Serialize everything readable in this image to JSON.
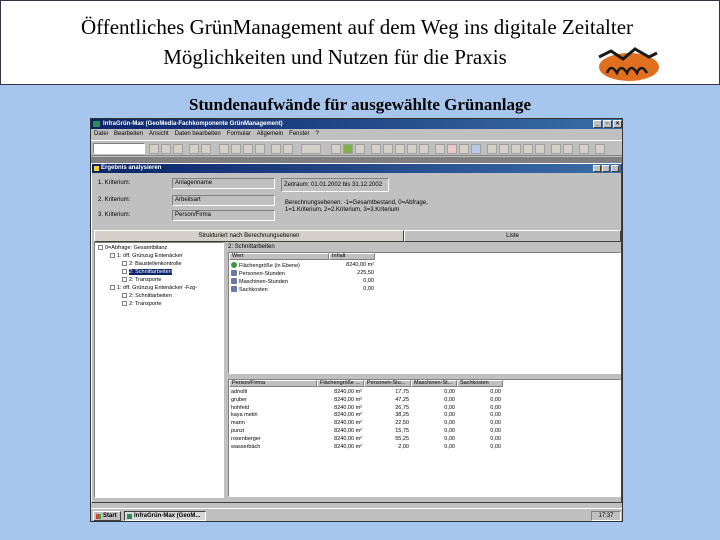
{
  "slide": {
    "title_line1": "Öffentliches GrünManagement auf dem Weg ins digitale Zeitalter",
    "title_line2": "Möglichkeiten und Nutzen für die Praxis",
    "subtitle": "Stundenaufwände für ausgewählte Grünanlage"
  },
  "app": {
    "window_title": "InfraGrün-Max (GeoMedia-Fachkomponente GrünManagement)",
    "window_controls": [
      "_",
      "▫",
      "×"
    ],
    "menu": [
      "Datei",
      "Bearbeiten",
      "Ansicht",
      "Daten bearbeiten",
      "Formular",
      "Allgemein",
      "Fenster",
      "?"
    ]
  },
  "dialog": {
    "title": "Ergebnis analysieren",
    "criteria": [
      {
        "label": "1. Kriterium:",
        "value": "Anlagenname"
      },
      {
        "label": "2. Kriterium:",
        "value": "Arbeitsart"
      },
      {
        "label": "3. Kriterium:",
        "value": "Person/Firma"
      }
    ],
    "zeitraum": "Zeitraum: 01.01.2002 bis 31.12.2002",
    "ebenen_line1": "Berechnungsebenen: -1=Gesamtbestand, 0=Abfrage,",
    "ebenen_line2": "1=1.Kriterium, 2=2.Kriterium, 3=3.Kriterium",
    "tabs": [
      "Strukturiert nach Berechnungsebenen",
      "Liste"
    ],
    "tree": [
      {
        "label": "0=Abfrage: Gesamtbilanz",
        "level": 0,
        "selected": false
      },
      {
        "label": "1: öff. Grünzug Entenäcker",
        "level": 1,
        "selected": false
      },
      {
        "label": "2: Baustellenkontrolle",
        "level": 2,
        "selected": false
      },
      {
        "label": "2: Schnittarbeiten",
        "level": 2,
        "selected": true
      },
      {
        "label": "2: Transporte",
        "level": 2,
        "selected": false
      },
      {
        "label": "1: öff. Grünzug Entenäcker -Fzg-",
        "level": 1,
        "selected": false
      },
      {
        "label": "2: Schnittarbeiten",
        "level": 2,
        "selected": false
      },
      {
        "label": "2: Transporte",
        "level": 2,
        "selected": false
      }
    ],
    "path": "2: Schnittarbeiten",
    "summary_headers": [
      "Wert",
      "Inhalt"
    ],
    "summary_rows": [
      {
        "label": "Flächengröße (in Ebene)",
        "value": "8240,00 m²",
        "icon": "tree-icon",
        "color": "#3a9a3a"
      },
      {
        "label": "Personen-Stunden",
        "value": "225,50",
        "icon": "person-hours-icon",
        "color": "#6a7aa8"
      },
      {
        "label": "Maschinen-Stunden",
        "value": "0,00",
        "icon": "machine-hours-icon",
        "color": "#6a7aa8"
      },
      {
        "label": "Sachkosten",
        "value": "0,00",
        "icon": "costs-icon",
        "color": "#6a7aa8"
      }
    ],
    "table_headers": [
      "Person/Firma",
      "Flächengröße ...",
      "Personen-Stu...",
      "Maschinen-St...",
      "Sachkosten"
    ],
    "table_rows": [
      [
        "adnolti",
        "8240,00 m²",
        "17,75",
        "0,00",
        "0,00"
      ],
      [
        "gruber",
        "8240,00 m²",
        "47,25",
        "0,00",
        "0,00"
      ],
      [
        "hohfeld",
        "8240,00 m²",
        "26,75",
        "0,00",
        "0,00"
      ],
      [
        "kaya metin",
        "8240,00 m²",
        "38,25",
        "0,00",
        "0,00"
      ],
      [
        "mann",
        "8240,00 m²",
        "22,50",
        "0,00",
        "0,00"
      ],
      [
        "punzi",
        "8240,00 m²",
        "15,75",
        "0,00",
        "0,00"
      ],
      [
        "rosenberger",
        "8240,00 m²",
        "55,25",
        "0,00",
        "0,00"
      ],
      [
        "wasserbäch",
        "8240,00 m²",
        "2,00",
        "0,00",
        "0,00"
      ]
    ]
  },
  "taskbar": {
    "start": "Start",
    "task": "InfraGrün-Max (GeoM...",
    "clock": "17:37"
  }
}
